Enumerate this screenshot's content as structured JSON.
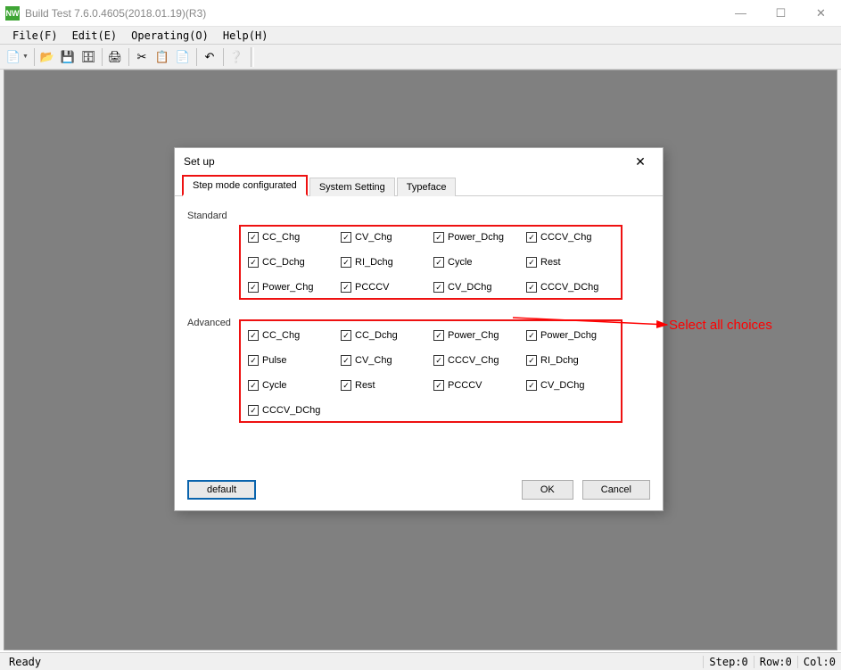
{
  "window": {
    "app_icon_text": "NW",
    "title": "Build Test  7.6.0.4605(2018.01.19)(R3)"
  },
  "menus": {
    "file": "File(F)",
    "edit": "Edit(E)",
    "operating": "Operating(O)",
    "help": "Help(H)"
  },
  "toolbar_icons": {
    "new": "📄",
    "open": "📂",
    "save": "💾",
    "saveall": "🗄",
    "print": "🖨",
    "cut": "✂",
    "copy": "📋",
    "paste": "📄",
    "undo": "↶",
    "help": "❔"
  },
  "statusbar": {
    "ready": "Ready",
    "step": "Step:0",
    "row": "Row:0",
    "col": "Col:0"
  },
  "dialog": {
    "title": "Set up",
    "tabs": {
      "step_mode": "Step mode configurated",
      "system_setting": "System Setting",
      "typeface": "Typeface"
    },
    "section_standard": "Standard",
    "section_advanced": "Advanced",
    "standard_items": [
      "CC_Chg",
      "CV_Chg",
      "Power_Dchg",
      "CCCV_Chg",
      "CC_Dchg",
      "RI_Dchg",
      "Cycle",
      "Rest",
      "Power_Chg",
      "PCCCV",
      "CV_DChg",
      "CCCV_DChg"
    ],
    "advanced_items": [
      "CC_Chg",
      "CC_Dchg",
      "Power_Chg",
      "Power_Dchg",
      "Pulse",
      "CV_Chg",
      "CCCV_Chg",
      "RI_Dchg",
      "Cycle",
      "Rest",
      "PCCCV",
      "CV_DChg",
      "CCCV_DChg"
    ],
    "buttons": {
      "default": "default",
      "ok": "OK",
      "cancel": "Cancel"
    }
  },
  "annotation": {
    "text": "Select all choices"
  }
}
